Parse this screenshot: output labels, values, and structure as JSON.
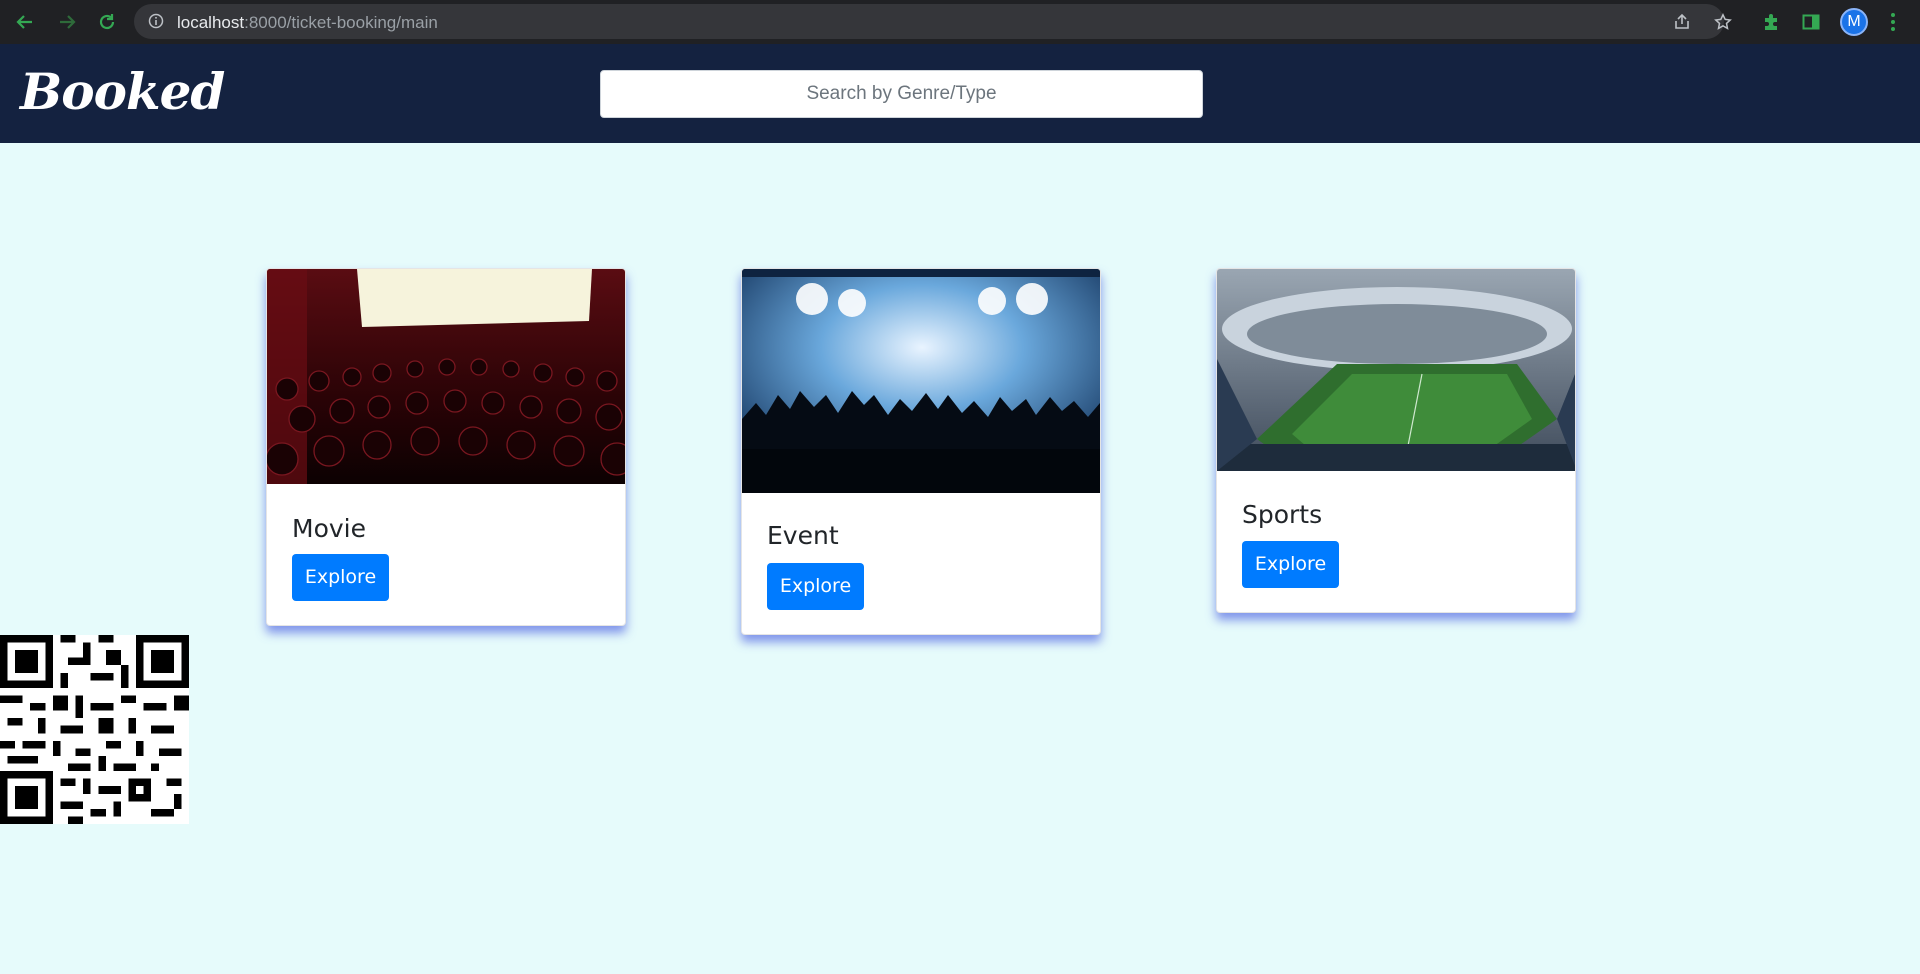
{
  "browser": {
    "url_host": "localhost",
    "url_rest": ":8000/ticket-booking/main",
    "avatar_letter": "M"
  },
  "app": {
    "logo": "Booked",
    "search_placeholder": "Search by Genre/Type"
  },
  "cards": [
    {
      "title": "Movie",
      "button": "Explore"
    },
    {
      "title": "Event",
      "button": "Explore"
    },
    {
      "title": "Sports",
      "button": "Explore"
    }
  ],
  "colors": {
    "navbar": "#142240",
    "page_bg": "#e6fbfb",
    "button": "#007bff",
    "card_shadow": "#5e72e4"
  }
}
